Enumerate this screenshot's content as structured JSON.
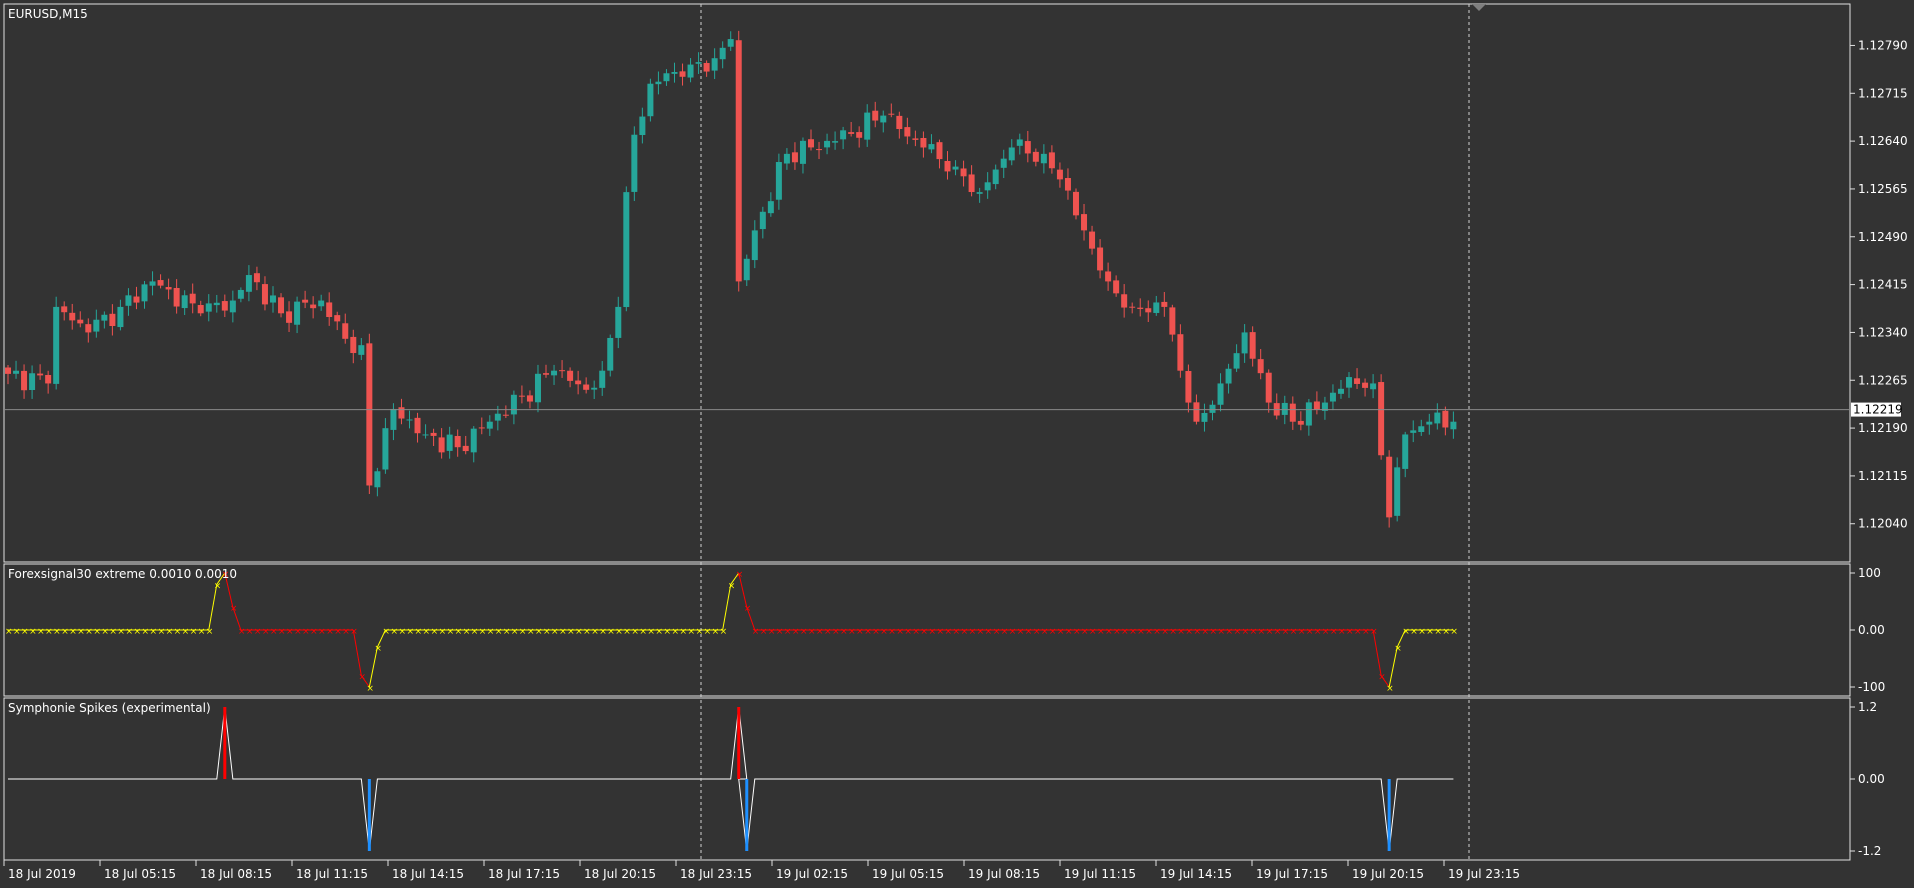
{
  "main": {
    "symbol_label": "EURUSD,M15",
    "price_ticks": [
      "1.12790",
      "1.12715",
      "1.12640",
      "1.12565",
      "1.12490",
      "1.12415",
      "1.12340",
      "1.12265",
      "1.12190",
      "1.12115",
      "1.12040"
    ],
    "current_price": "1.12219",
    "price_range": [
      1.1198,
      1.12855
    ]
  },
  "indicator1": {
    "label": "Forexsignal30 extreme 0.0010 0.0010",
    "ticks": [
      "100",
      "0.00",
      "-100"
    ]
  },
  "indicator2": {
    "label": "Symphonie Spikes (experimental)",
    "ticks": [
      "1.2",
      "0.00",
      "-1.2"
    ]
  },
  "time_ticks": [
    "18 Jul 2019",
    "18 Jul 05:15",
    "18 Jul 08:15",
    "18 Jul 11:15",
    "18 Jul 14:15",
    "18 Jul 17:15",
    "18 Jul 20:15",
    "18 Jul 23:15",
    "19 Jul 02:15",
    "19 Jul 05:15",
    "19 Jul 08:15",
    "19 Jul 11:15",
    "19 Jul 14:15",
    "19 Jul 17:15",
    "19 Jul 20:15",
    "19 Jul 23:15"
  ],
  "colors": {
    "background": "#333333",
    "bull": "#26a69a",
    "bear": "#ef5350",
    "signal_up": "#ffff00",
    "signal_down": "#ff0000",
    "spike_line": "#ffffff",
    "spike_up": "#ff0000",
    "spike_down": "#1e90ff"
  },
  "chart_data": {
    "type": "candlestick",
    "timeframe": "M15",
    "close_anchors": [
      [
        0,
        1.12275
      ],
      [
        5,
        1.1226
      ],
      [
        6,
        1.1238
      ],
      [
        10,
        1.1234
      ],
      [
        14,
        1.1238
      ],
      [
        18,
        1.1242
      ],
      [
        24,
        1.1237
      ],
      [
        28,
        1.1239
      ],
      [
        30,
        1.1243
      ],
      [
        34,
        1.1237
      ],
      [
        39,
        1.1239
      ],
      [
        42,
        1.1233
      ],
      [
        44,
        1.1232
      ],
      [
        45,
        1.121
      ],
      [
        48,
        1.1222
      ],
      [
        52,
        1.1218
      ],
      [
        56,
        1.1216
      ],
      [
        60,
        1.122
      ],
      [
        64,
        1.1224
      ],
      [
        68,
        1.1228
      ],
      [
        72,
        1.1225
      ],
      [
        74,
        1.1228
      ],
      [
        76,
        1.1238
      ],
      [
        77,
        1.1256
      ],
      [
        78,
        1.1265
      ],
      [
        80,
        1.1273
      ],
      [
        85,
        1.1276
      ],
      [
        88,
        1.1277
      ],
      [
        90,
        1.128
      ],
      [
        91,
        1.1242
      ],
      [
        93,
        1.125
      ],
      [
        97,
        1.1262
      ],
      [
        103,
        1.1264
      ],
      [
        109,
        1.1268
      ],
      [
        114,
        1.1263
      ],
      [
        118,
        1.126
      ],
      [
        121,
        1.1256
      ],
      [
        125,
        1.1263
      ],
      [
        129,
        1.1262
      ],
      [
        131,
        1.1258
      ],
      [
        134,
        1.125
      ],
      [
        137,
        1.1242
      ],
      [
        140,
        1.1238
      ],
      [
        144,
        1.1238
      ],
      [
        146,
        1.1228
      ],
      [
        148,
        1.122
      ],
      [
        151,
        1.1226
      ],
      [
        154,
        1.1234
      ],
      [
        157,
        1.1223
      ],
      [
        160,
        1.122
      ],
      [
        164,
        1.1223
      ],
      [
        167,
        1.1227
      ],
      [
        170,
        1.1226
      ],
      [
        172,
        1.1205
      ],
      [
        174,
        1.1218
      ],
      [
        177,
        1.122
      ],
      [
        180,
        1.122
      ]
    ],
    "forexsignal30": [
      {
        "bar": 0,
        "value": 0
      },
      {
        "bar": 25,
        "value": 0
      },
      {
        "bar": 26,
        "value": 80
      },
      {
        "bar": 27,
        "value": 100
      },
      {
        "bar": 28,
        "value": 40
      },
      {
        "bar": 29,
        "value": 0
      },
      {
        "bar": 43,
        "value": 0
      },
      {
        "bar": 44,
        "value": -80
      },
      {
        "bar": 45,
        "value": -100
      },
      {
        "bar": 46,
        "value": -30
      },
      {
        "bar": 47,
        "value": 0
      },
      {
        "bar": 89,
        "value": 0
      },
      {
        "bar": 90,
        "value": 80
      },
      {
        "bar": 91,
        "value": 100
      },
      {
        "bar": 92,
        "value": 40
      },
      {
        "bar": 93,
        "value": 0
      },
      {
        "bar": 170,
        "value": 0
      },
      {
        "bar": 171,
        "value": -80
      },
      {
        "bar": 172,
        "value": -100
      },
      {
        "bar": 173,
        "value": -30
      },
      {
        "bar": 174,
        "value": 0
      },
      {
        "bar": 180,
        "value": 0
      }
    ],
    "symphonie_spikes": [
      {
        "bar": 27,
        "value": 1.2
      },
      {
        "bar": 45,
        "value": -1.2
      },
      {
        "bar": 91,
        "value": 1.2
      },
      {
        "bar": 92,
        "value": -1.2
      },
      {
        "bar": 172,
        "value": -1.2
      }
    ]
  }
}
